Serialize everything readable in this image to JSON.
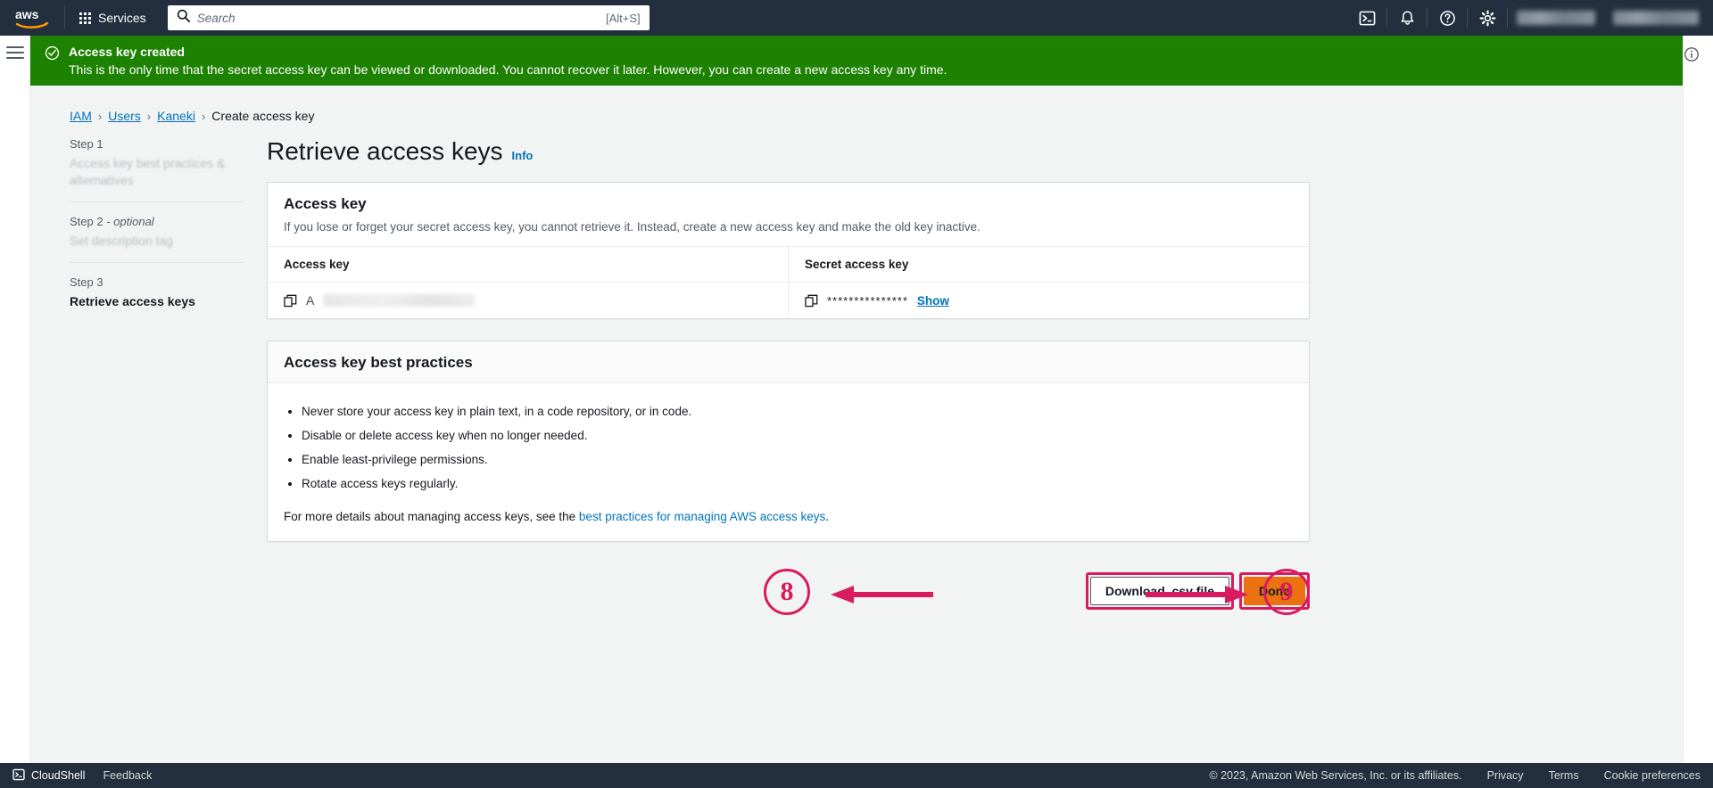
{
  "topnav": {
    "logo_alt": "aws",
    "services_label": "Services",
    "search": {
      "placeholder": "Search",
      "value": "",
      "shortcut_hint": "[Alt+S]"
    },
    "icons": [
      "cloudshell-icon",
      "notifications-bell-icon",
      "help-circle-icon",
      "settings-gear-icon"
    ]
  },
  "flashbar": {
    "title": "Access key created",
    "description": "This is the only time that the secret access key can be viewed or downloaded. You cannot recover it later. However, you can create a new access key any time.",
    "status_color": "#1d8102"
  },
  "breadcrumb": {
    "items": [
      {
        "label": "IAM",
        "link": true
      },
      {
        "label": "Users",
        "link": true
      },
      {
        "label": "Kaneki",
        "link": true
      },
      {
        "label": "Create access key",
        "link": false
      }
    ],
    "separator": "›"
  },
  "steps": [
    {
      "step": "Step 1",
      "optional": "",
      "name": "Access key best practices & alternatives",
      "state": "done"
    },
    {
      "step": "Step 2 ",
      "optional": "- optional",
      "name": "Set description tag",
      "state": "done"
    },
    {
      "step": "Step 3",
      "optional": "",
      "name": "Retrieve access keys",
      "state": "current"
    }
  ],
  "main": {
    "title": "Retrieve access keys",
    "info_label": "Info",
    "access_key_card": {
      "title": "Access key",
      "description": "If you lose or forget your secret access key, you cannot retrieve it. Instead, create a new access key and make the old key inactive.",
      "columns": [
        "Access key",
        "Secret access key"
      ],
      "access_key_prefix": "A",
      "access_key_redacted": true,
      "secret_masked": "***************",
      "show_label": "Show",
      "copy_icon": "copy-icon"
    },
    "best_practices_card": {
      "title": "Access key best practices",
      "items": [
        "Never store your access key in plain text, in a code repository, or in code.",
        "Disable or delete access key when no longer needed.",
        "Enable least-privilege permissions.",
        "Rotate access keys regularly."
      ],
      "footer_prefix": "For more details about managing access keys, see the ",
      "footer_link": "best practices for managing AWS access keys",
      "footer_suffix": "."
    },
    "actions": {
      "download_label": "Download .csv file",
      "done_label": "Done"
    }
  },
  "annotations": {
    "accent_color": "#d81b60",
    "markers": [
      {
        "number": "8",
        "target": "download-csv-button",
        "arrow": "left"
      },
      {
        "number": "9",
        "target": "done-button",
        "arrow": "right"
      }
    ]
  },
  "right_rail": {
    "icon": "info-circle-icon"
  },
  "footer": {
    "cloudshell_label": "CloudShell",
    "feedback_label": "Feedback",
    "copyright": "© 2023, Amazon Web Services, Inc. or its affiliates.",
    "links": [
      "Privacy",
      "Terms",
      "Cookie preferences"
    ]
  }
}
